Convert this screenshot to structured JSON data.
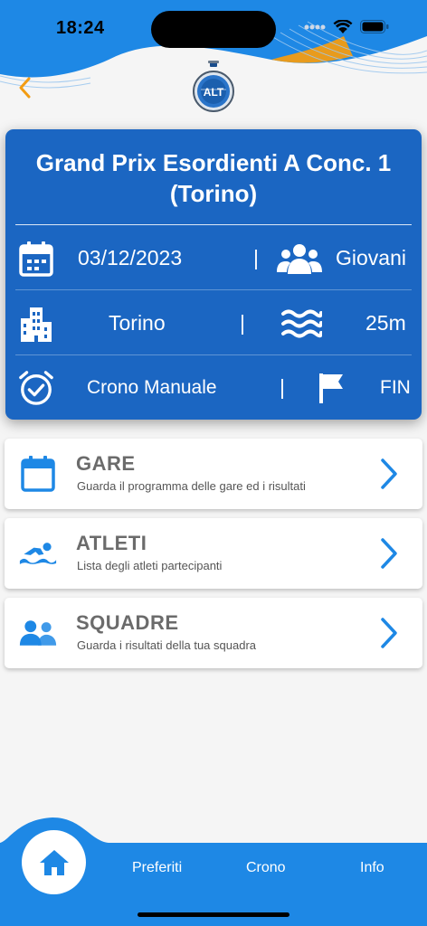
{
  "status_bar": {
    "time": "18:24"
  },
  "header": {
    "back_icon": "chevron-left-icon",
    "logo_icon": "stopwatch-logo-icon",
    "logo_text": "ALT",
    "accent_color": "#f39c12",
    "brand_color": "#1e88e5"
  },
  "event": {
    "title": "Grand Prix Esordienti A Conc. 1 (Torino)",
    "date": "03/12/2023",
    "category": "Giovani",
    "city": "Torino",
    "pool": "25m",
    "timing": "Crono Manuale",
    "federation": "FIN",
    "separator": "|",
    "card_color": "#1b66c2"
  },
  "menu": [
    {
      "title": "GARE",
      "subtitle": "Guarda il programma delle gare ed i risultati",
      "icon": "calendar-icon"
    },
    {
      "title": "ATLETI",
      "subtitle": "Lista degli atleti partecipanti",
      "icon": "swimmer-icon"
    },
    {
      "title": "SQUADRE",
      "subtitle": "Guarda i risultati della tua squadra",
      "icon": "team-icon"
    }
  ],
  "tabbar": {
    "home_icon": "home-icon",
    "tabs": [
      {
        "label": "Preferiti"
      },
      {
        "label": "Crono"
      },
      {
        "label": "Info"
      }
    ]
  }
}
